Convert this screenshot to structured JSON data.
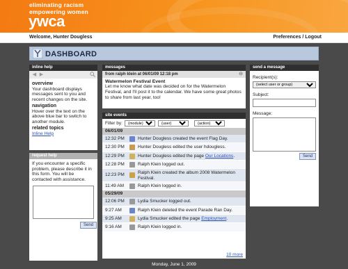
{
  "header": {
    "tagline_line1": "eliminating racism",
    "tagline_line2": "empowering women",
    "logo_text": "ywca",
    "brand_color": "#f7941d"
  },
  "userbar": {
    "welcome": "Welcome, Hunter Dougless",
    "preferences": "Preferences",
    "separator": " / ",
    "logout": "Logout"
  },
  "dashboard": {
    "title": "DASHBOARD",
    "icon": "ywca-y-icon"
  },
  "inline_help": {
    "title": "inline help",
    "sections": [
      {
        "heading": "overview",
        "text": "Your dashboard displays messages sent to you and recent changes on the site."
      },
      {
        "heading": "navigation",
        "text": "Hover over the text on the above blue bar to switch to another module."
      },
      {
        "heading": "related topics",
        "link": "Inline Help"
      }
    ]
  },
  "request_help": {
    "title": "request help",
    "text": "If you encounter a specific problem, please describe it in this form. You will be contacted with assistance.",
    "send_label": "Send"
  },
  "messages": {
    "title": "messages",
    "from_line": "from ralph klein at 06/01/09 12:18 pm",
    "subject": "Watermelon Festival Event",
    "body": "Let me know what date was decided on for the Watermelon Festival, and I'll post it to the calendar. We have some great photos to share from last year, too!"
  },
  "site_events": {
    "title": "site events",
    "filter_label": "Filter by:",
    "filters": [
      "(module)",
      "(user)",
      "(action)"
    ],
    "groups": [
      {
        "date": "06/01/09",
        "rows": [
          {
            "time": "12:32 PM",
            "text": "Hunter Dougless created the event Flag Day.",
            "icon": "calendar-icon",
            "color": "#6a86c8"
          },
          {
            "time": "12:30 PM",
            "text": "Hunter Dougless edited the user hdougless.",
            "icon": "user-icon",
            "color": "#c89a54"
          },
          {
            "time": "12:29 PM",
            "text": "Hunter Dougless edited the page ",
            "link": "Our Locations",
            "after": ".",
            "icon": "page-icon",
            "color": "#d2b15e"
          },
          {
            "time": "12:28 PM",
            "text": "Ralph Klein logged out.",
            "icon": "logout-icon",
            "color": "#999999"
          },
          {
            "time": "12:23 PM",
            "text": "Ralph Klein created the album 2008 Watermelon Festival.",
            "icon": "album-icon",
            "color": "#c9a24a",
            "tall": true
          },
          {
            "time": "11:49 AM",
            "text": "Ralph Klein logged in.",
            "icon": "login-icon",
            "color": "#999999"
          }
        ]
      },
      {
        "date": "05/29/09",
        "rows": [
          {
            "time": "12:06 PM",
            "text": "Lydia Smucker logged out.",
            "icon": "logout-icon",
            "color": "#999999"
          },
          {
            "time": "9:27 AM",
            "text": "Ralph Klein deleted the event Parade Ran Day.",
            "icon": "calendar-icon",
            "color": "#6a86c8"
          },
          {
            "time": "9:25 AM",
            "text": "Lydia Smucker edited the page ",
            "link": "Employment",
            "after": ".",
            "icon": "page-icon",
            "color": "#d2b15e"
          },
          {
            "time": "9:16 AM",
            "text": "Ralph Klein logged in.",
            "icon": "login-icon",
            "color": "#999999"
          }
        ]
      }
    ],
    "more_label": "10 more"
  },
  "send_message": {
    "title": "send a message",
    "recipients_label": "Recipient(s):",
    "recipients_option": "(select user or group)",
    "subject_label": "Subject:",
    "message_label": "Message:",
    "send_label": "Send"
  },
  "footer": {
    "date": "Monday, June 1, 2009"
  }
}
